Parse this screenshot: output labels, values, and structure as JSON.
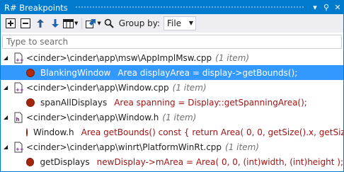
{
  "window": {
    "title": "R# Breakpoints",
    "dropdown_glyph": "▾",
    "pin_glyph": "⚲",
    "close_glyph": "✕"
  },
  "toolbar": {
    "group_by_label": "Group by:",
    "group_by_value": "File",
    "icons": [
      "enable-all-icon",
      "disable-all-icon",
      "move-up-icon",
      "move-down-icon",
      "columns-icon",
      "export-icon",
      "search-options-icon"
    ]
  },
  "search": {
    "placeholder": "Type to search"
  },
  "groups": [
    {
      "path": "<cinder>\\cinder\\app\\msw\\AppImplMsw.cpp",
      "count": "(1 item)",
      "breakpoints": [
        {
          "member": "BlankingWindow",
          "code": "Area displayArea = display->getBounds();",
          "selected": true
        }
      ]
    },
    {
      "path": "<cinder>\\cinder\\app\\Window.cpp",
      "count": "(1 item)",
      "breakpoints": [
        {
          "member": "spanAllDisplays",
          "code": "Area spanning = Display::getSpanningArea();",
          "selected": false
        }
      ]
    },
    {
      "path": "<cinder>\\cinder\\app\\Window.h",
      "count": "(1 item)",
      "breakpoints": [
        {
          "member": "Window.h",
          "code": "Area getBounds() const { return Area( 0, 0, getSize().x, getSize().y ); }",
          "selected": false
        }
      ]
    },
    {
      "path": "<cinder>\\cinder\\app\\winrt\\PlatformWinRt.cpp",
      "count": "(1 item)",
      "breakpoints": [
        {
          "member": "getDisplays",
          "code": "newDisplay->mArea = Area( 0, 0, (int)width, (int)height );",
          "selected": false
        }
      ]
    }
  ],
  "colors": {
    "accent": "#007acc",
    "selection": "#3399ff",
    "breakpoint": "#a1260d",
    "code": "#a31515"
  }
}
